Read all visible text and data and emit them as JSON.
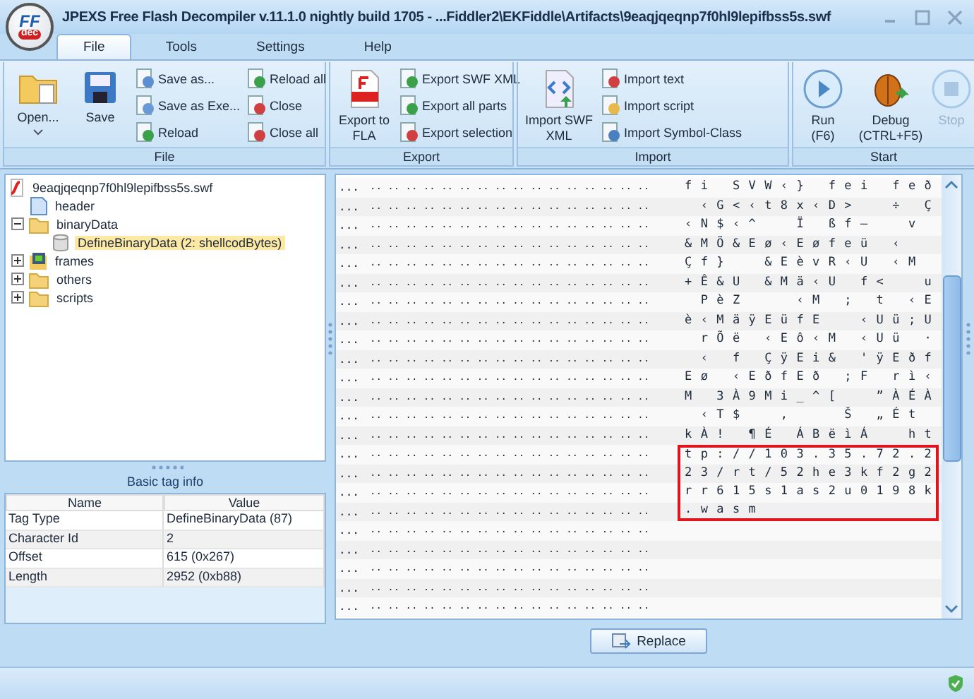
{
  "window": {
    "title": "JPEXS Free Flash Decompiler v.11.1.0 nightly build 1705 - ...Fiddler2\\EKFiddle\\Artifacts\\9eaqjqeqnp7f0hl9lepifbss5s.swf",
    "logo": {
      "line1": "FF",
      "line2": "dec"
    }
  },
  "menu_tabs": [
    {
      "label": "File",
      "selected": true
    },
    {
      "label": "Tools",
      "selected": false
    },
    {
      "label": "Settings",
      "selected": false
    },
    {
      "label": "Help",
      "selected": false
    }
  ],
  "ribbon": [
    {
      "title": "File",
      "buttons": [
        {
          "kind": "large",
          "label": "Open...",
          "dropdown": true,
          "disabled": false
        },
        {
          "kind": "large",
          "label": "Save",
          "disabled": false
        },
        {
          "kind": "small",
          "label": "Save as...",
          "disabled": false
        },
        {
          "kind": "small",
          "label": "Save as Exe...",
          "disabled": false
        },
        {
          "kind": "small",
          "label": "Reload",
          "disabled": false
        },
        {
          "kind": "small",
          "label": "Reload all",
          "disabled": false
        },
        {
          "kind": "small",
          "label": "Close",
          "disabled": false
        },
        {
          "kind": "small",
          "label": "Close all",
          "disabled": false
        }
      ]
    },
    {
      "title": "Export",
      "buttons": [
        {
          "kind": "large",
          "label": "Export to FLA",
          "disabled": false
        },
        {
          "kind": "small",
          "label": "Export SWF XML",
          "disabled": false
        },
        {
          "kind": "small",
          "label": "Export all parts",
          "disabled": false
        },
        {
          "kind": "small",
          "label": "Export selection",
          "disabled": false
        }
      ]
    },
    {
      "title": "Import",
      "buttons": [
        {
          "kind": "large",
          "label": "Import SWF XML",
          "disabled": false
        },
        {
          "kind": "small",
          "label": "Import text",
          "disabled": false
        },
        {
          "kind": "small",
          "label": "Import script",
          "disabled": false
        },
        {
          "kind": "small",
          "label": "Import Symbol-Class",
          "disabled": false
        }
      ]
    },
    {
      "title": "Start",
      "buttons": [
        {
          "kind": "large",
          "label": "Run (F6)",
          "disabled": false
        },
        {
          "kind": "large",
          "label": "Debug (CTRL+F5)",
          "disabled": false
        },
        {
          "kind": "large",
          "label": "Stop",
          "disabled": true
        }
      ]
    }
  ],
  "tree": [
    {
      "label": "9eaqjqeqnp7f0hl9lepifbss5s.swf",
      "selected": false,
      "children": [
        {
          "label": "header",
          "selected": false
        },
        {
          "label": "binaryData",
          "expanded": true,
          "selected": false,
          "children": [
            {
              "label": "DefineBinaryData (2: shellcodBytes)",
              "selected": true
            }
          ]
        },
        {
          "label": "frames",
          "expanded": false,
          "selected": false
        },
        {
          "label": "others",
          "expanded": false,
          "selected": false
        },
        {
          "label": "scripts",
          "expanded": false,
          "selected": false
        }
      ]
    }
  ],
  "tag_info": {
    "title": "Basic tag info",
    "columns": [
      "Name",
      "Value"
    ],
    "rows": [
      [
        "Tag Type",
        "DefineBinaryData (87)"
      ],
      [
        "Character Id",
        "2"
      ],
      [
        "Offset",
        "615 (0x267)"
      ],
      [
        "Length",
        "2952 (0xb88)"
      ]
    ]
  },
  "hex_rows": [
    {
      "offset": "...",
      "hex": ".. .. .. .. .. .. .. .. .. .. .. .. .. .. .. ..",
      "ascii": "fi SVW‹} fei feð",
      "marked": false
    },
    {
      "offset": "...",
      "hex": ".. .. .. .. .. .. .. .. .. .. .. .. .. .. .. ..",
      "ascii": " ‹G<‹t8x‹D>  ÷ Ç",
      "marked": false
    },
    {
      "offset": "...",
      "hex": ".. .. .. .. .. .. .. .. .. .. .. .. .. .. .. ..",
      "ascii": "‹N$‹^  Ï ßf–  v ",
      "marked": false
    },
    {
      "offset": "...",
      "hex": ".. .. .. .. .. .. .. .. .. .. .. .. .. .. .. ..",
      "ascii": "&MÕ&Eø‹Eøfeü ‹  ",
      "marked": false
    },
    {
      "offset": "...",
      "hex": ".. .. .. .. .. .. .. .. .. .. .. .. .. .. .. ..",
      "ascii": "Çf}  &EèvR‹U ‹M ",
      "marked": false
    },
    {
      "offset": "...",
      "hex": ".. .. .. .. .. .. .. .. .. .. .. .. .. .. .. ..",
      "ascii": "+Ê&U &Mä‹U f<  u",
      "marked": false
    },
    {
      "offset": "...",
      "hex": ".. .. .. .. .. .. .. .. .. .. .. .. .. .. .. ..",
      "ascii": " PèZ   ‹M ; t ‹E",
      "marked": false
    },
    {
      "offset": "...",
      "hex": ".. .. .. .. .. .. .. .. .. .. .. .. .. .. .. ..",
      "ascii": "è‹MäÿEüfE  ‹Uü;U",
      "marked": false
    },
    {
      "offset": "...",
      "hex": ".. .. .. .. .. .. .. .. .. .. .. .. .. .. .. ..",
      "ascii": " rÕë ‹Eô‹M ‹Uü ·",
      "marked": false
    },
    {
      "offset": "...",
      "hex": ".. .. .. .. .. .. .. .. .. .. .. .. .. .. .. ..",
      "ascii": " ‹ f ÇÿEi& 'ÿEðf",
      "marked": false
    },
    {
      "offset": "...",
      "hex": ".. .. .. .. .. .. .. .. .. .. .. .. .. .. .. ..",
      "ascii": "Eø ‹EðfEð ;F rì‹",
      "marked": false
    },
    {
      "offset": "...",
      "hex": ".. .. .. .. .. .. .. .. .. .. .. .. .. .. .. ..",
      "ascii": "M 3À9Mi_^[  ”ÀÉÀ",
      "marked": false
    },
    {
      "offset": "...",
      "hex": ".. .. .. .. .. .. .. .. .. .. .. .. .. .. .. ..",
      "ascii": " ‹T$  ‚   Š „Ét",
      "marked": false
    },
    {
      "offset": "...",
      "hex": ".. .. .. .. .. .. .. .. .. .. .. .. .. .. .. ..",
      "ascii": "kÀ! ¶É ÁBëìÁ  ht",
      "marked": false
    },
    {
      "offset": "...",
      "hex": ".. .. .. .. .. .. .. .. .. .. .. .. .. .. .. ..",
      "ascii": "tp://103.35.72.2",
      "marked": true
    },
    {
      "offset": "...",
      "hex": ".. .. .. .. .. .. .. .. .. .. .. .. .. .. .. ..",
      "ascii": "23/rt/52he3kf2g2",
      "marked": true
    },
    {
      "offset": "...",
      "hex": ".. .. .. .. .. .. .. .. .. .. .. .. .. .. .. ..",
      "ascii": "rr615s1as2u0198k",
      "marked": true
    },
    {
      "offset": "...",
      "hex": ".. .. .. .. .. .. .. .. .. .. .. .. .. .. .. ..",
      "ascii": ".wasm",
      "marked": true
    },
    {
      "offset": "...",
      "hex": ".. .. .. .. .. .. .. .. .. .. .. .. .. .. .. ..",
      "marked": false
    },
    {
      "offset": "...",
      "hex": ".. .. .. .. .. .. .. .. .. .. .. .. .. .. .. ..",
      "marked": false
    },
    {
      "offset": "...",
      "hex": ".. .. .. .. .. .. .. .. .. .. .. .. .. .. .. ..",
      "marked": false
    },
    {
      "offset": "...",
      "hex": ".. .. .. .. .. .. .. .. .. .. .. .. .. .. .. ..",
      "marked": false
    },
    {
      "offset": "...",
      "hex": ".. .. .. .. .. .. .. .. .. .. .. .. .. .. .. ..",
      "marked": false
    }
  ],
  "replace_button": "Replace"
}
